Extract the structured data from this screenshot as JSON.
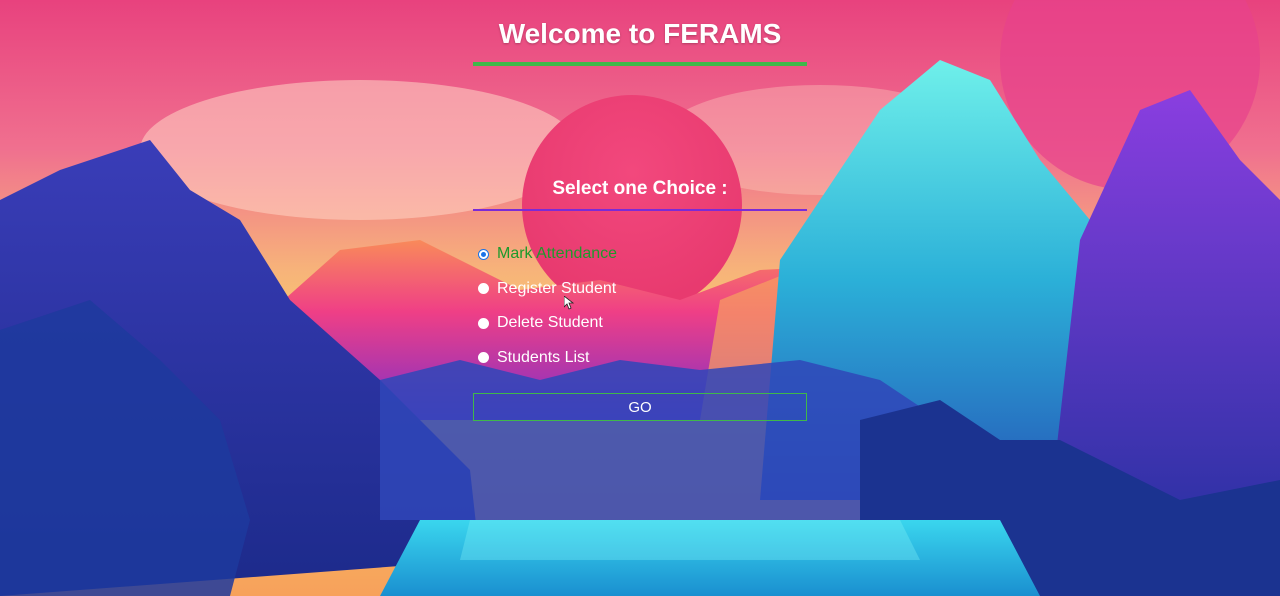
{
  "header": {
    "title": "Welcome to FERAMS"
  },
  "form": {
    "heading": "Select one Choice :",
    "options": [
      {
        "label": "Mark Attendance",
        "selected": true
      },
      {
        "label": "Register Student",
        "selected": false
      },
      {
        "label": "Delete Student",
        "selected": false
      },
      {
        "label": "Students List",
        "selected": false
      }
    ],
    "submit_label": "GO"
  },
  "colors": {
    "accent_green": "#3fb84a",
    "heading_rule_purple": "#7b2bd6",
    "selected_text_green": "#1e9a2c",
    "radio_blue": "#1a73e8"
  },
  "background": {
    "icon": "mountain-sunset-landscape"
  }
}
